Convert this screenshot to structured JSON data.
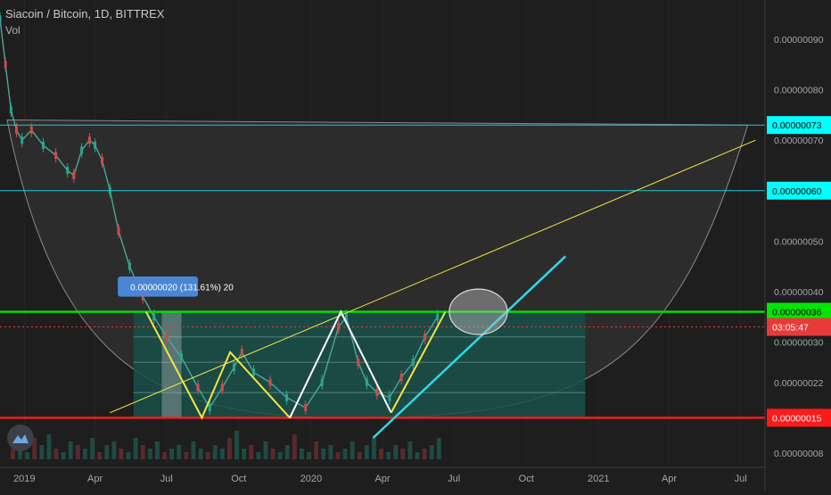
{
  "header": {
    "symbol": "Siacoin / Bitcoin, 1D, BITTREX",
    "indicator": "Vol"
  },
  "colors": {
    "background": "#1e1e1e",
    "green_line": "#00e600",
    "red_line": "#ff1a1a",
    "cyan_line": "#1ec8d2",
    "teal_line": "#17a2a2",
    "yellow_line": "#f0e640",
    "bowl_fill": "#2c2c2c",
    "range_fill": "#19504a",
    "tooltip_bg": "#4a86d4"
  },
  "logo_icon": "tradingview-logo-icon",
  "measure_tooltip": {
    "text": "0.00000020 (131.61%) 20"
  },
  "chart_data": {
    "type": "candlestick",
    "symbol": "SC/BTC",
    "timeframe": "1D",
    "exchange": "BITTREX",
    "x_range": [
      "2018-12-01",
      "2021-08-01"
    ],
    "y_range": [
      7.5e-09,
      9.6e-09
    ],
    "x_tick_labels": [
      {
        "label": "2019",
        "date": "2019-01-01"
      },
      {
        "label": "Apr",
        "date": "2019-04-01"
      },
      {
        "label": "Jul",
        "date": "2019-07-01"
      },
      {
        "label": "Oct",
        "date": "2019-10-01"
      },
      {
        "label": "2020",
        "date": "2020-01-01"
      },
      {
        "label": "Apr",
        "date": "2020-04-01"
      },
      {
        "label": "Jul",
        "date": "2020-07-01"
      },
      {
        "label": "Oct",
        "date": "2020-10-01"
      },
      {
        "label": "2021",
        "date": "2021-01-01"
      },
      {
        "label": "Apr",
        "date": "2021-04-01"
      },
      {
        "label": "Jul",
        "date": "2021-07-01"
      }
    ],
    "y_tick_labels": [
      {
        "label": "0.00000090",
        "value": 9e-09
      },
      {
        "label": "0.00000080",
        "value": 8e-09
      },
      {
        "label": "0.00000070",
        "value": 7e-09
      },
      {
        "label": "0.00000050",
        "value": 5e-09
      },
      {
        "label": "0.00000040",
        "value": 4e-09
      },
      {
        "label": "0.00000030",
        "value": 3e-09
      },
      {
        "label": "0.00000022",
        "value": 2.2e-09
      },
      {
        "label": "0.00000008",
        "value": 8e-10
      }
    ],
    "price_labels": [
      {
        "text": "0.00000073",
        "value": 7.3e-09,
        "color": "#00ffff",
        "text_color": "#000000"
      },
      {
        "text": "0.00000060",
        "value": 6e-09,
        "color": "#00ffff",
        "text_color": "#000000"
      },
      {
        "text": "0.00000036",
        "value": 3.6e-09,
        "color": "#00e600",
        "text_color": "#000000"
      },
      {
        "text": "03:05:47",
        "value": 3.3e-09,
        "color": "#e83a3a",
        "text_color": "#ffffff"
      },
      {
        "text": "0.00000015",
        "value": 1.5e-09,
        "color": "#ff1a1a",
        "text_color": "#ffffff"
      }
    ],
    "price_path": [
      [
        "2018-12-01",
        9.4e-09
      ],
      [
        "2018-12-08",
        8.5e-09
      ],
      [
        "2018-12-15",
        7.6e-09
      ],
      [
        "2018-12-22",
        7.2e-09
      ],
      [
        "2018-12-29",
        7e-09
      ],
      [
        "2019-01-10",
        7.2e-09
      ],
      [
        "2019-01-25",
        6.9e-09
      ],
      [
        "2019-02-10",
        6.7e-09
      ],
      [
        "2019-02-25",
        6.4e-09
      ],
      [
        "2019-03-05",
        6.3e-09
      ],
      [
        "2019-03-15",
        6.8e-09
      ],
      [
        "2019-03-25",
        7e-09
      ],
      [
        "2019-04-01",
        6.9e-09
      ],
      [
        "2019-04-10",
        6.6e-09
      ],
      [
        "2019-04-20",
        6e-09
      ],
      [
        "2019-05-01",
        5.2e-09
      ],
      [
        "2019-05-15",
        4.5e-09
      ],
      [
        "2019-06-01",
        3.9e-09
      ],
      [
        "2019-06-15",
        3.5e-09
      ],
      [
        "2019-07-01",
        3.1e-09
      ],
      [
        "2019-07-20",
        2.7e-09
      ],
      [
        "2019-08-10",
        2.1e-09
      ],
      [
        "2019-08-25",
        1.7e-09
      ],
      [
        "2019-09-10",
        2.1e-09
      ],
      [
        "2019-09-25",
        2.5e-09
      ],
      [
        "2019-10-05",
        2.8e-09
      ],
      [
        "2019-10-20",
        2.4e-09
      ],
      [
        "2019-11-10",
        2.2e-09
      ],
      [
        "2019-12-01",
        1.9e-09
      ],
      [
        "2019-12-25",
        1.7e-09
      ],
      [
        "2020-01-15",
        2.2e-09
      ],
      [
        "2020-02-05",
        3.3e-09
      ],
      [
        "2020-02-15",
        3.5e-09
      ],
      [
        "2020-03-01",
        2.6e-09
      ],
      [
        "2020-03-12",
        2.2e-09
      ],
      [
        "2020-03-25",
        2e-09
      ],
      [
        "2020-04-10",
        1.9e-09
      ],
      [
        "2020-04-25",
        2.3e-09
      ],
      [
        "2020-05-10",
        2.6e-09
      ],
      [
        "2020-05-25",
        3.1e-09
      ],
      [
        "2020-06-10",
        3.5e-09
      ]
    ],
    "volume_bars": [
      3,
      5,
      2,
      6,
      4,
      7,
      3,
      2,
      5,
      4,
      3,
      6,
      2,
      4,
      5,
      3,
      2,
      6,
      4,
      3,
      5,
      2,
      3,
      4,
      2,
      5,
      3,
      2,
      4,
      3,
      6,
      8,
      3,
      4,
      2,
      5,
      3,
      2,
      4,
      7,
      3,
      2,
      5,
      3,
      4,
      2,
      3,
      5,
      2,
      4,
      6,
      3,
      2,
      4,
      3,
      5,
      2,
      3,
      4,
      6
    ],
    "horizontal_lines": [
      {
        "name": "cyan-line-73",
        "value": 7.3e-09,
        "color": "#1ec8d2",
        "from": "2018-12-01"
      },
      {
        "name": "cyan-line-60",
        "value": 6e-09,
        "color": "#1ec8d2",
        "from": "2018-12-01"
      },
      {
        "name": "green-line-36",
        "value": 3.6e-09,
        "color": "#00e600",
        "from": "2018-12-01"
      },
      {
        "name": "red-line-15",
        "value": 1.5e-09,
        "color": "#ff1a1a",
        "from": "2018-12-01"
      },
      {
        "name": "dotted-current-price",
        "value": 3.3e-09,
        "color": "#e83a3a",
        "from": "2018-12-01",
        "dashed": true
      }
    ],
    "range_box": {
      "from": "2019-05-20",
      "to": "2020-12-15",
      "top": 3.6e-09,
      "bottom": 1.5e-09,
      "levels": [
        3.6e-09,
        3.1e-09,
        2.6e-09,
        2e-09
      ]
    },
    "highlight_box": {
      "from": "2019-06-25",
      "to": "2019-07-20",
      "top": 3.6e-09,
      "bottom": 1.5e-09
    },
    "bowl": {
      "left": [
        "2018-12-10",
        7.4e-09
      ],
      "bottom": [
        "2020-03-15",
        1.5e-09
      ],
      "right": [
        "2021-07-10",
        7.3e-09
      ]
    },
    "trend_line_yellow_thin": [
      [
        "2019-04-20",
        1.6e-09
      ],
      [
        "2021-07-20",
        7e-09
      ]
    ],
    "zigzag": [
      {
        "points": [
          [
            "2019-06-05",
            3.6e-09
          ],
          [
            "2019-08-15",
            1.5e-09
          ],
          [
            "2019-09-20",
            2.8e-09
          ],
          [
            "2019-12-05",
            1.5e-09
          ]
        ],
        "color": "#f0e640"
      },
      {
        "points": [
          [
            "2019-12-05",
            1.5e-09
          ],
          [
            "2020-02-08",
            3.6e-09
          ],
          [
            "2020-04-12",
            1.6e-09
          ]
        ],
        "color": "#ffffff"
      },
      {
        "points": [
          [
            "2020-04-12",
            1.6e-09
          ],
          [
            "2020-05-20",
            2.7e-09
          ],
          [
            "2020-06-20",
            3.6e-09
          ]
        ],
        "color": "#f0e640"
      }
    ],
    "trend_line_cyan": [
      [
        "2020-03-20",
        1.1e-09
      ],
      [
        "2020-11-20",
        4.7e-09
      ]
    ],
    "ellipse": {
      "center": [
        "2020-08-01",
        3.6e-09
      ],
      "rx_days": 37,
      "ry_value": 4.5e-10
    },
    "measure_box": {
      "from": "2019-04-30",
      "to": "2019-08-10",
      "top": 4.3e-09,
      "bottom": 3.9e-09
    }
  }
}
